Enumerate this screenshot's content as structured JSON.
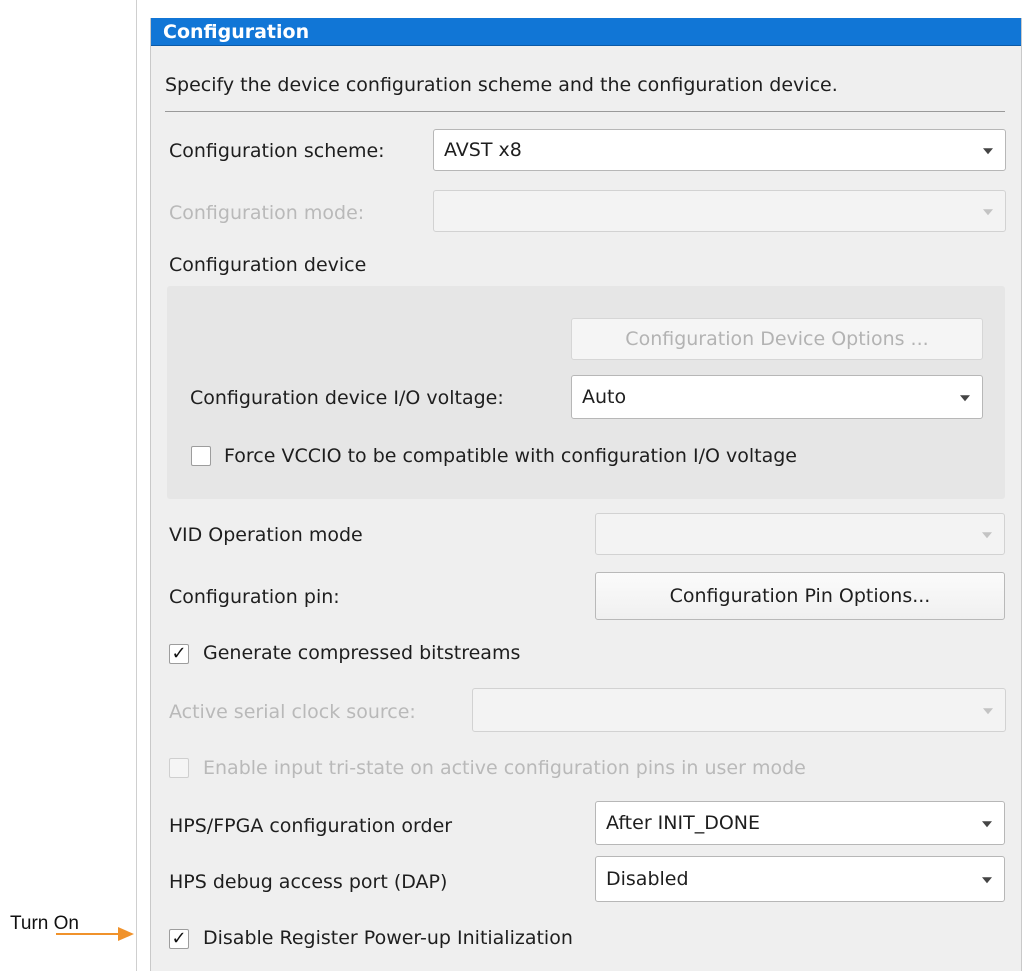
{
  "window": {
    "title": "Configuration",
    "description": "Specify the device configuration scheme and the configuration device."
  },
  "config_scheme": {
    "label": "Configuration scheme:",
    "value": "AVST x8"
  },
  "config_mode": {
    "label": "Configuration mode:",
    "value": ""
  },
  "config_device": {
    "label": "Configuration device",
    "options_button": "Configuration Device Options ...",
    "io_voltage_label": "Configuration device I/O voltage:",
    "io_voltage_value": "Auto",
    "force_vccio_label": "Force VCCIO to be compatible with configuration I/O voltage",
    "force_vccio_checked": false
  },
  "vid_operation": {
    "label": "VID Operation mode",
    "value": ""
  },
  "config_pin": {
    "label": "Configuration pin:",
    "button": "Configuration Pin Options..."
  },
  "compressed_bitstreams": {
    "label": "Generate compressed bitstreams",
    "checked": true
  },
  "serial_clock": {
    "label": "Active serial clock source:",
    "value": ""
  },
  "tristate": {
    "label": "Enable input tri-state on active configuration pins in user mode",
    "checked": false
  },
  "hps_order": {
    "label": "HPS/FPGA configuration order",
    "value": "After INIT_DONE"
  },
  "hps_debug": {
    "label": "HPS debug access port (DAP)",
    "value": "Disabled"
  },
  "disable_reg": {
    "label": "Disable Register Power-up Initialization",
    "checked": true
  },
  "annotation": {
    "text": "Turn On",
    "color": "#f0922b"
  },
  "colors": {
    "accent": "#1176d6"
  }
}
